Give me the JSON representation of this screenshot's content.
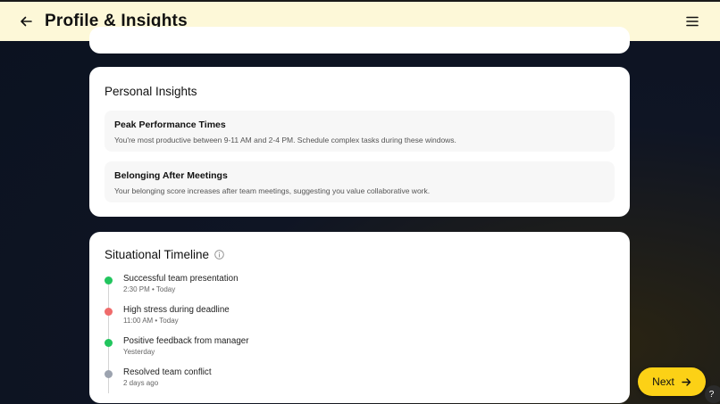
{
  "header": {
    "title": "Profile & Insights",
    "back_icon": "back-arrow-icon",
    "menu_icon": "hamburger-menu-icon"
  },
  "insights": {
    "title": "Personal Insights",
    "items": [
      {
        "title": "Peak Performance Times",
        "description": "You're most productive between 9-11 AM and 2-4 PM. Schedule complex tasks during these windows."
      },
      {
        "title": "Belonging After Meetings",
        "description": "Your belonging score increases after team meetings, suggesting you value collaborative work."
      }
    ]
  },
  "timeline": {
    "title": "Situational Timeline",
    "info_icon": "info-icon",
    "items": [
      {
        "title": "Successful team presentation",
        "time": "2:30 PM • Today",
        "color": "#22c55e"
      },
      {
        "title": "High stress during deadline",
        "time": "11:00 AM • Today",
        "color": "#ef6b6b"
      },
      {
        "title": "Positive feedback from manager",
        "time": "Yesterday",
        "color": "#22c55e"
      },
      {
        "title": "Resolved team conflict",
        "time": "2 days ago",
        "color": "#9ca3af"
      }
    ]
  },
  "footer": {
    "next_label": "Next",
    "help_label": "?"
  },
  "colors": {
    "header_bg": "#fdf8d8",
    "accent": "#fcd116",
    "background": "#0f1524"
  }
}
